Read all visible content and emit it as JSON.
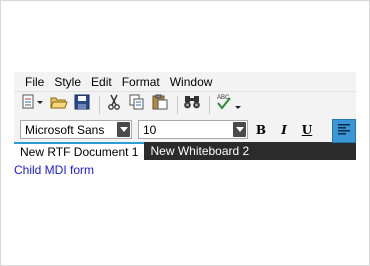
{
  "menu": [
    "File",
    "Style",
    "Edit",
    "Format",
    "Window"
  ],
  "toolbar": {
    "icons": [
      "new-document-icon",
      "open-folder-icon",
      "save-icon",
      "cut-icon",
      "copy-icon",
      "paste-icon",
      "find-icon",
      "spell-check-icon"
    ]
  },
  "format_bar": {
    "font_name": "Microsoft Sans",
    "font_size": "10",
    "bold": "B",
    "italic": "I",
    "underline": "U"
  },
  "tabs": [
    {
      "label": "New RTF Document 1",
      "active": true
    },
    {
      "label": "New Whiteboard 2",
      "active": false
    }
  ],
  "child_text": "Child MDI form",
  "colors": {
    "accent": "#2a9fd6",
    "tab_bar": "#2b2b2b",
    "link": "#1a1ae6"
  }
}
